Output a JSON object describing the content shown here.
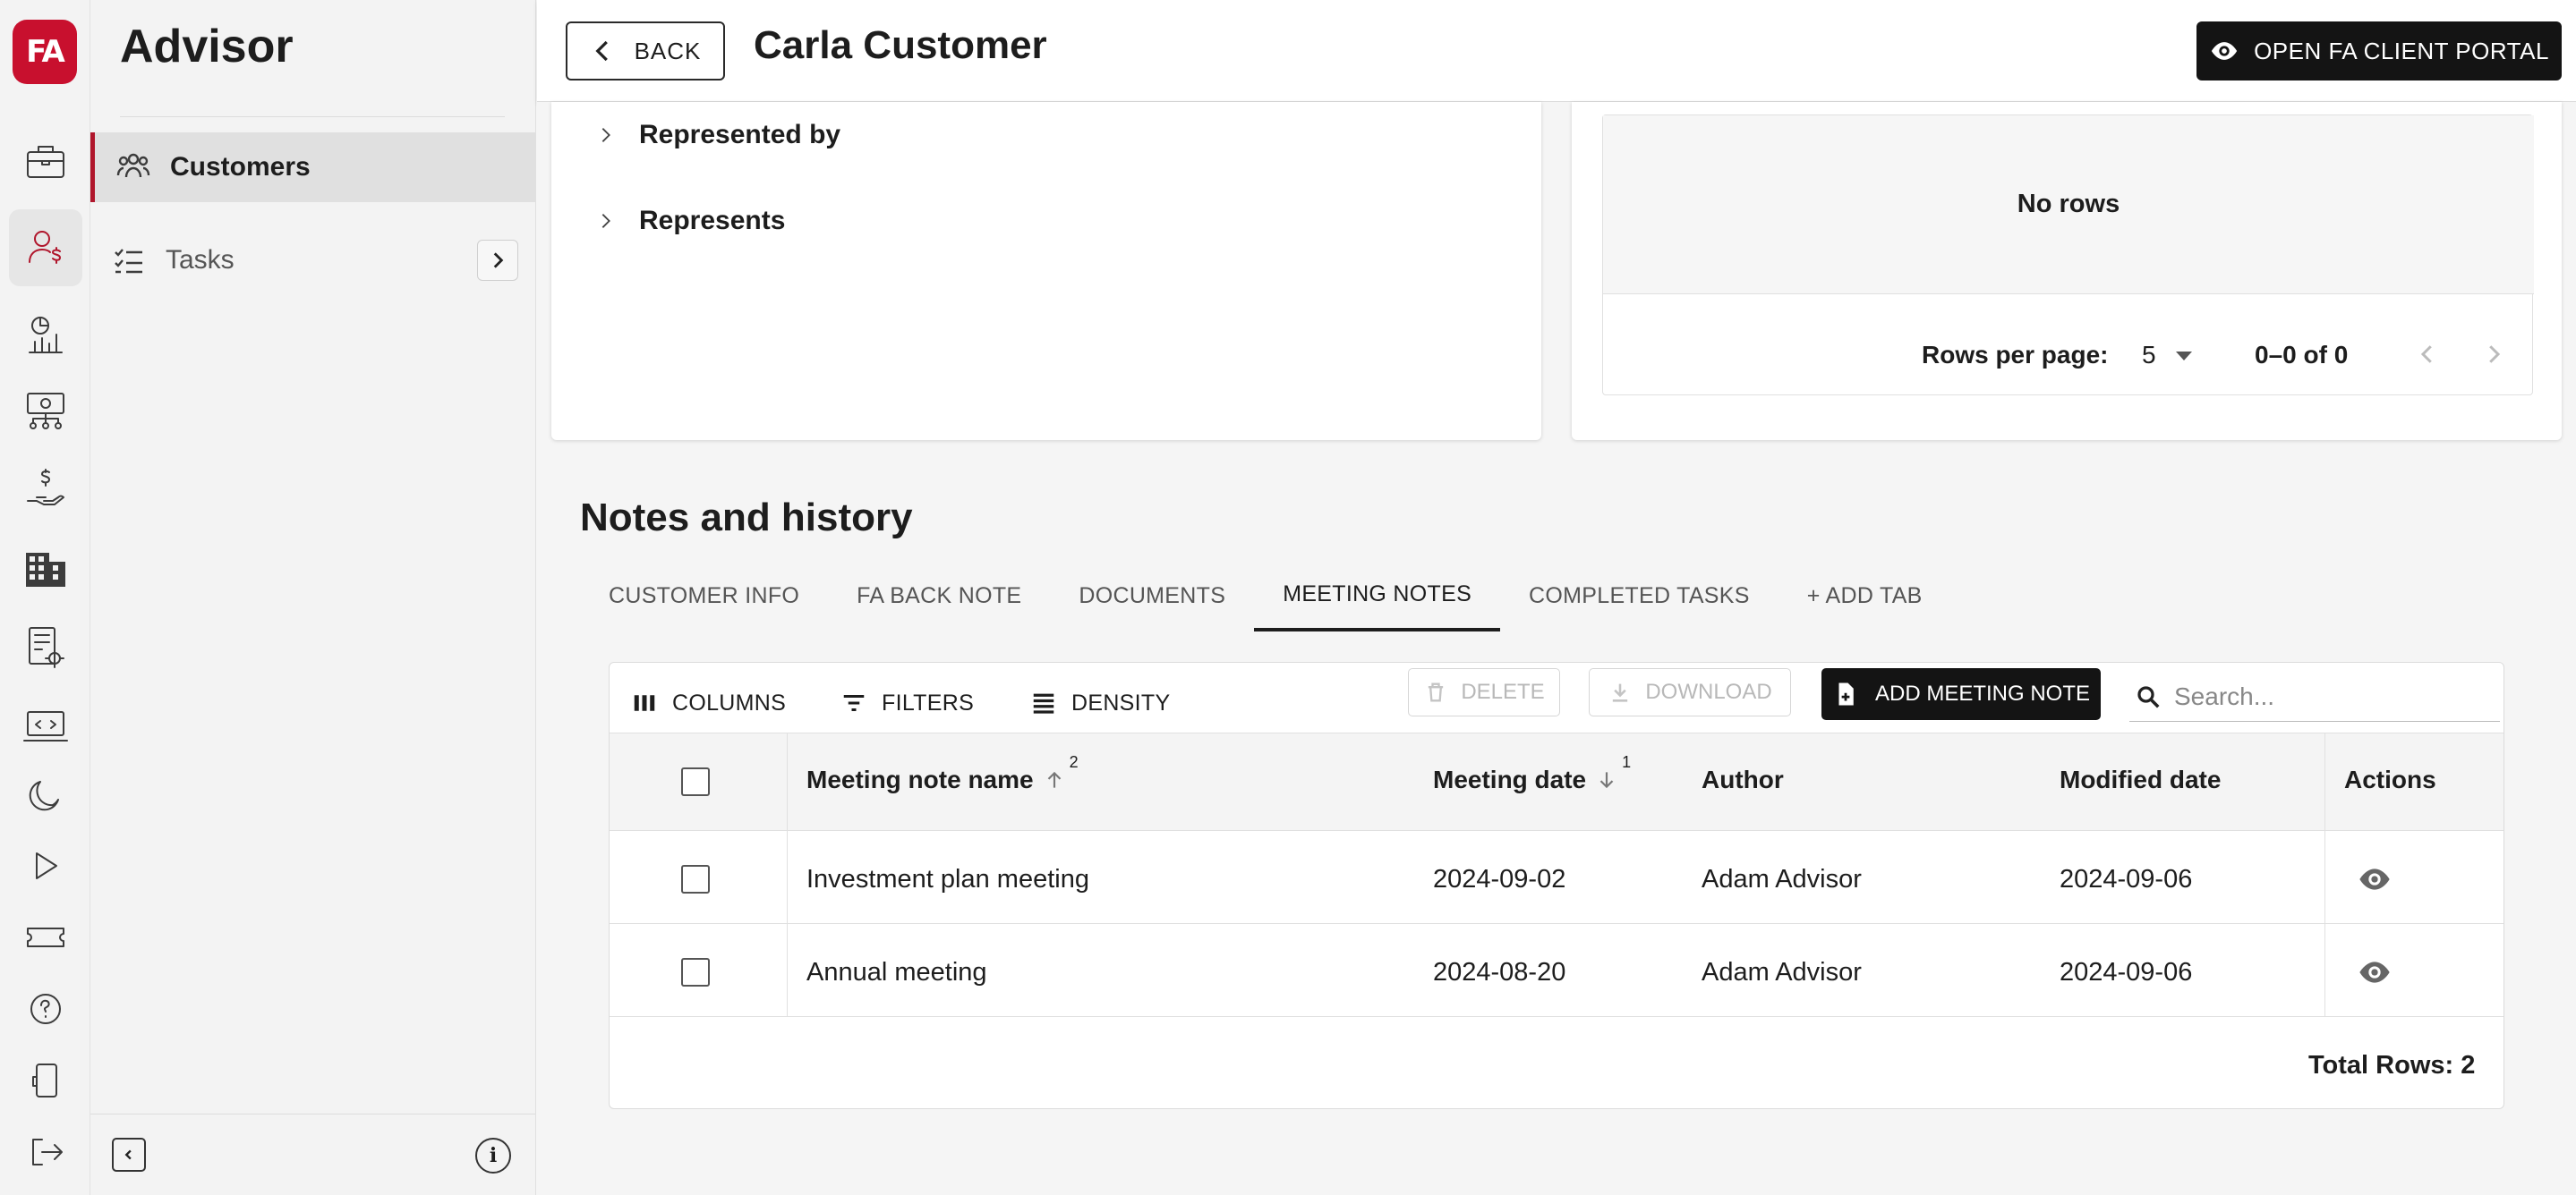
{
  "app": {
    "logo_text": "FA",
    "section_title": "Advisor"
  },
  "rail": {
    "icons": [
      "briefcase-icon",
      "customers-dollar-icon",
      "chart-report-icon",
      "money-network-icon",
      "hand-dollar-icon",
      "building-icon",
      "doc-settings-icon",
      "laptop-code-icon",
      "moon-icon",
      "play-icon",
      "ticket-icon",
      "help-icon",
      "mobile-icon",
      "logout-icon"
    ],
    "active": "customers-dollar-icon"
  },
  "sidebar": {
    "items": [
      {
        "label": "Customers",
        "icon": "people-icon",
        "active": true
      },
      {
        "label": "Tasks",
        "icon": "checklist-icon",
        "active": false
      }
    ]
  },
  "header": {
    "back_label": "BACK",
    "title": "Carla Customer",
    "portal_label": "OPEN FA CLIENT PORTAL"
  },
  "relations": {
    "items": [
      "Represented by",
      "Represents"
    ]
  },
  "right_grid": {
    "empty_text": "No rows",
    "rows_per_page_label": "Rows per page:",
    "rows_per_page_value": "5",
    "range_text": "0–0 of 0"
  },
  "notes": {
    "title": "Notes and history",
    "tabs": [
      "CUSTOMER INFO",
      "FA BACK NOTE",
      "DOCUMENTS",
      "MEETING NOTES",
      "COMPLETED TASKS",
      "+ ADD TAB"
    ],
    "active_tab": "MEETING NOTES",
    "toolbar": {
      "columns": "COLUMNS",
      "filters": "FILTERS",
      "density": "DENSITY",
      "delete": "DELETE",
      "download": "DOWNLOAD",
      "add": "ADD MEETING NOTE",
      "search_placeholder": "Search..."
    },
    "columns": {
      "name": "Meeting note name",
      "name_sort": "2",
      "date": "Meeting date",
      "date_sort": "1",
      "author": "Author",
      "modified": "Modified date",
      "actions": "Actions"
    },
    "rows": [
      {
        "name": "Investment plan meeting",
        "date": "2024-09-02",
        "author": "Adam Advisor",
        "modified": "2024-09-06"
      },
      {
        "name": "Annual meeting",
        "date": "2024-08-20",
        "author": "Adam Advisor",
        "modified": "2024-09-06"
      }
    ],
    "total_rows": "Total Rows: 2"
  },
  "colors": {
    "brand": "#c8102e",
    "accent": "#b0162c",
    "dark_button": "#141414"
  }
}
